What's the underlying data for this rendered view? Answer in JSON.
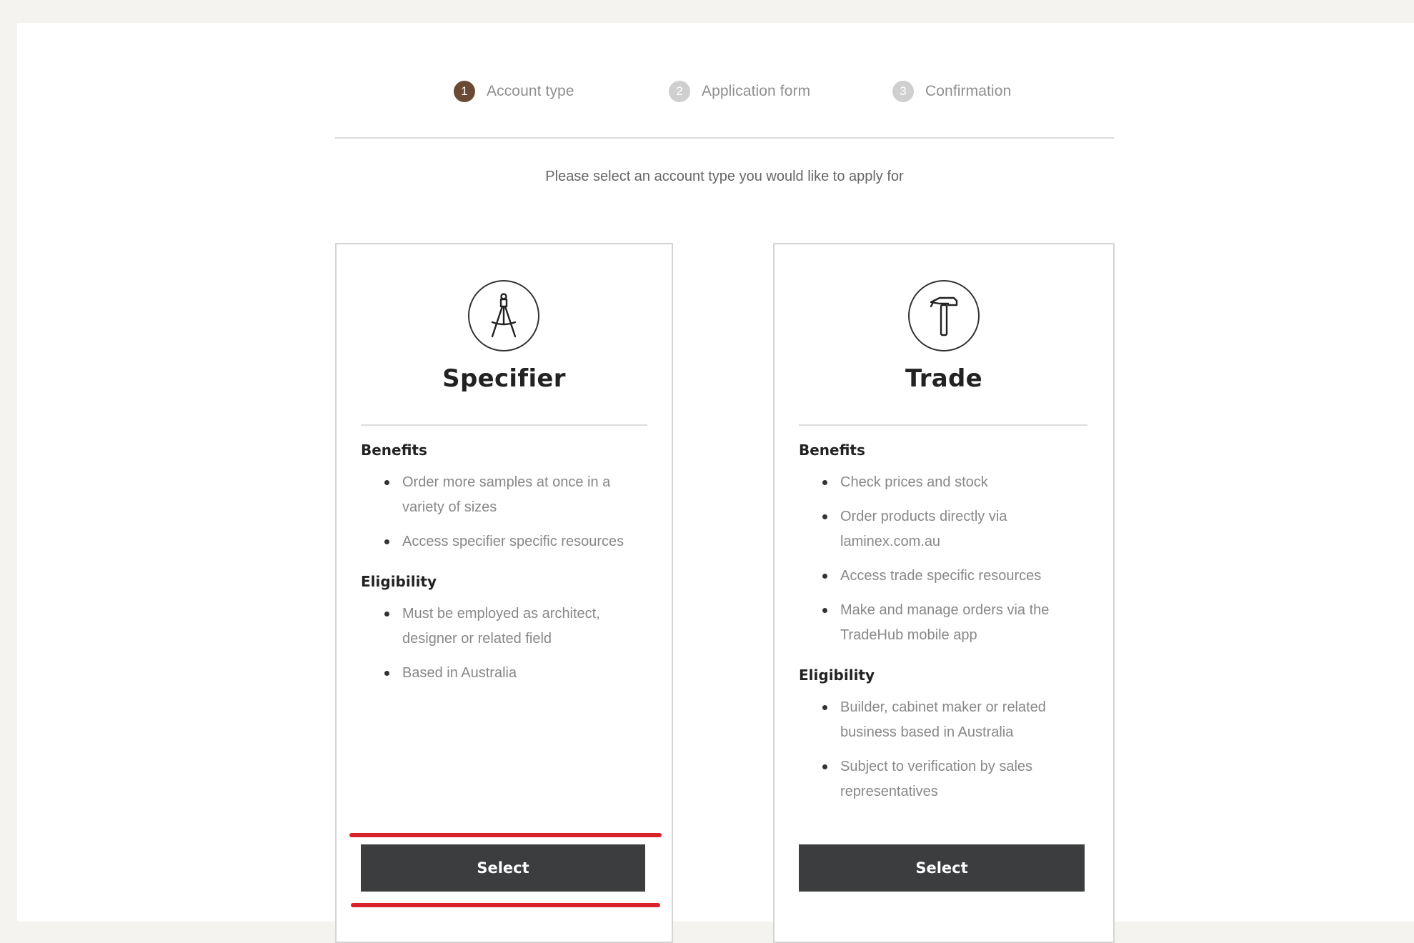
{
  "stepper": {
    "steps": [
      {
        "number": "1",
        "label": "Account type",
        "active": true
      },
      {
        "number": "2",
        "label": "Application form",
        "active": false
      },
      {
        "number": "3",
        "label": "Confirmation",
        "active": false
      }
    ]
  },
  "instruction": "Please select an account type you would like to apply for",
  "cards": {
    "specifier": {
      "icon": "drafting-compass-icon",
      "title": "Specifier",
      "benefits_title": "Benefits",
      "benefits": [
        "Order more samples at once in a variety of sizes",
        "Access specifier specific resources"
      ],
      "eligibility_title": "Eligibility",
      "eligibility": [
        "Must be employed as architect, designer or related field",
        "Based in Australia"
      ],
      "select_label": "Select"
    },
    "trade": {
      "icon": "hammer-icon",
      "title": "Trade",
      "benefits_title": "Benefits",
      "benefits": [
        "Check prices and stock",
        "Order products directly via laminex.com.au",
        "Access trade specific resources",
        "Make and manage orders via the TradeHub mobile app"
      ],
      "eligibility_title": "Eligibility",
      "eligibility": [
        "Builder, cabinet maker or related business based in Australia",
        "Subject to verification by sales representatives"
      ],
      "select_label": "Select"
    }
  },
  "colors": {
    "active_step": "#6b4a35",
    "button": "#3b3d3f",
    "highlight": "#d9232a"
  }
}
